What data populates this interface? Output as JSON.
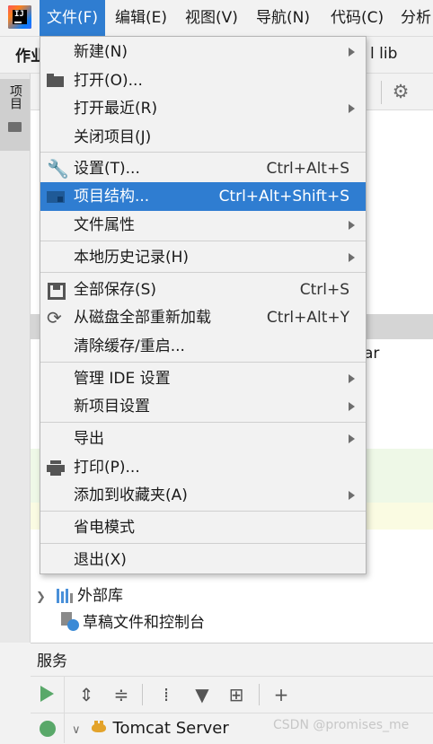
{
  "menubar": {
    "items": [
      {
        "label": "文件(F)"
      },
      {
        "label": "编辑(E)"
      },
      {
        "label": "视图(V)"
      },
      {
        "label": "导航(N)"
      },
      {
        "label": "代码(C)"
      },
      {
        "label": "分析"
      }
    ]
  },
  "toolbar": {
    "left_text": "作业",
    "right_text": "l lib"
  },
  "left_strip": {
    "project_tab_label": "项目"
  },
  "project_panel": {
    "partial_text": "ar",
    "tree": [
      {
        "label": "外部库"
      },
      {
        "label": "草稿文件和控制台"
      }
    ]
  },
  "file_menu": {
    "items": [
      {
        "label": "新建(N)",
        "submenu": true
      },
      {
        "label": "打开(O)...",
        "icon": "folder-open-icon"
      },
      {
        "label": "打开最近(R)",
        "submenu": true
      },
      {
        "label": "关闭项目(J)"
      },
      {
        "label": "设置(T)...",
        "shortcut": "Ctrl+Alt+S",
        "icon": "wrench-icon"
      },
      {
        "label": "项目结构...",
        "shortcut": "Ctrl+Alt+Shift+S",
        "icon": "project-structure-icon",
        "selected": true
      },
      {
        "label": "文件属性",
        "submenu": true
      },
      {
        "label": "本地历史记录(H)",
        "submenu": true
      },
      {
        "label": "全部保存(S)",
        "shortcut": "Ctrl+S",
        "icon": "save-icon"
      },
      {
        "label": "从磁盘全部重新加载",
        "shortcut": "Ctrl+Alt+Y",
        "icon": "reload-icon"
      },
      {
        "label": "清除缓存/重启..."
      },
      {
        "label": "管理 IDE 设置",
        "submenu": true
      },
      {
        "label": "新项目设置",
        "submenu": true
      },
      {
        "label": "导出",
        "submenu": true
      },
      {
        "label": "打印(P)...",
        "icon": "print-icon"
      },
      {
        "label": "添加到收藏夹(A)",
        "submenu": true
      },
      {
        "label": "省电模式"
      },
      {
        "label": "退出(X)"
      }
    ]
  },
  "services": {
    "title": "服务",
    "tomcat_label": "Tomcat Server"
  },
  "watermark": "CSDN @promises_me",
  "colors": {
    "accent": "#2f7dd1",
    "run_green": "#59a869"
  }
}
